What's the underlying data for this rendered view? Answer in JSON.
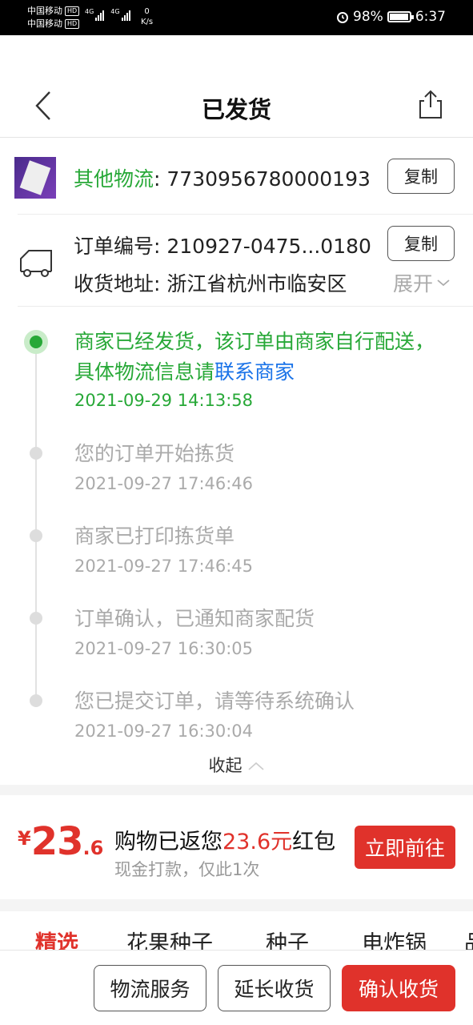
{
  "status_bar": {
    "carrier1": "中国移动",
    "carrier2": "中国移动",
    "hd": "HD",
    "net1": "4G",
    "net2": "4G",
    "speed_value": "0",
    "speed_unit": "K/s",
    "battery": "98%",
    "time": "6:37",
    "icons": [
      "alarm-icon",
      "battery-icon",
      "signal-icon"
    ]
  },
  "header": {
    "title": "已发货",
    "back_icon": "chevron-left-icon",
    "share_icon": "share-icon"
  },
  "logistics": {
    "company_label": "其他物流",
    "tracking_number": ": 7730956780000193",
    "copy_label": "复制"
  },
  "order": {
    "order_no_text": "订单编号: 210927-0475...0180",
    "copy_label": "复制",
    "address_text": "收货地址: 浙江省杭州市临安区",
    "expand_label": "展开"
  },
  "timeline": [
    {
      "text_main": "商家已经发货，该订单由商家自行配送，具体物流信息请",
      "link": "联系商家",
      "time": "2021-09-29 14:13:58"
    },
    {
      "text_main": "您的订单开始拣货",
      "time": "2021-09-27 17:46:46"
    },
    {
      "text_main": "商家已打印拣货单",
      "time": "2021-09-27 17:46:45"
    },
    {
      "text_main": "订单确认，已通知商家配货",
      "time": "2021-09-27 16:30:05"
    },
    {
      "text_main": "您已提交订单，请等待系统确认",
      "time": "2021-09-27 16:30:04"
    }
  ],
  "collapse_label": "收起",
  "promo": {
    "currency": "¥",
    "amount_int": "23",
    "amount_dec": ".6",
    "title_prefix": "购物已返您",
    "title_amount": "23.6元",
    "title_suffix": "红包",
    "subtitle": "现金打款，仅此1次",
    "button": "立即前往"
  },
  "tabs": [
    "精选",
    "花果种子",
    "种子",
    "电炸锅",
    "品"
  ],
  "bottom_bar": {
    "logistics_service": "物流服务",
    "extend_receipt": "延长收货",
    "confirm_receipt": "确认收货"
  },
  "colors": {
    "accent_red": "#e0322b",
    "accent_green": "#27a837",
    "link_blue": "#1a73e8"
  }
}
